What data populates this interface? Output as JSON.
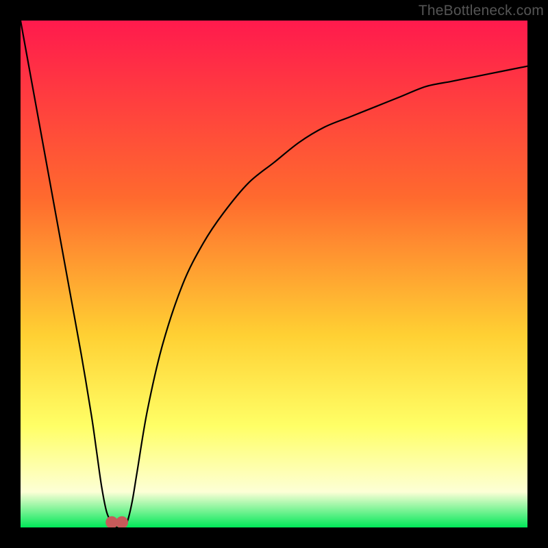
{
  "attribution": "TheBottleneck.com",
  "colors": {
    "frame": "#000000",
    "grad_top": "#ff1a4d",
    "grad_mid1": "#ff6a2e",
    "grad_mid2": "#ffd033",
    "grad_mid3": "#ffff66",
    "grad_mid4": "#fdffd6",
    "grad_bottom": "#00e858",
    "curve": "#000000",
    "marker": "#c75a5a"
  },
  "chart_data": {
    "type": "line",
    "title": "",
    "xlabel": "",
    "ylabel": "",
    "xlim": [
      0,
      100
    ],
    "ylim": [
      0,
      100
    ],
    "grid": false,
    "background_gradient": [
      "red",
      "orange",
      "yellow",
      "pale-yellow",
      "green"
    ],
    "series": [
      {
        "name": "bottleneck-curve",
        "x": [
          0,
          2,
          4,
          6,
          8,
          10,
          12,
          14,
          15,
          16,
          17,
          18,
          19,
          20,
          21,
          22,
          23,
          25,
          28,
          32,
          36,
          40,
          45,
          50,
          55,
          60,
          65,
          70,
          75,
          80,
          85,
          90,
          95,
          100
        ],
        "values": [
          100,
          89,
          78,
          67,
          56,
          45,
          34,
          22,
          15,
          8,
          3,
          1,
          0,
          0,
          1,
          5,
          11,
          23,
          36,
          48,
          56,
          62,
          68,
          72,
          76,
          79,
          81,
          83,
          85,
          87,
          88,
          89,
          90,
          91
        ]
      }
    ],
    "markers": [
      {
        "name": "min-left",
        "x": 18,
        "y": 1
      },
      {
        "name": "min-right",
        "x": 20,
        "y": 1
      }
    ],
    "annotations": []
  }
}
